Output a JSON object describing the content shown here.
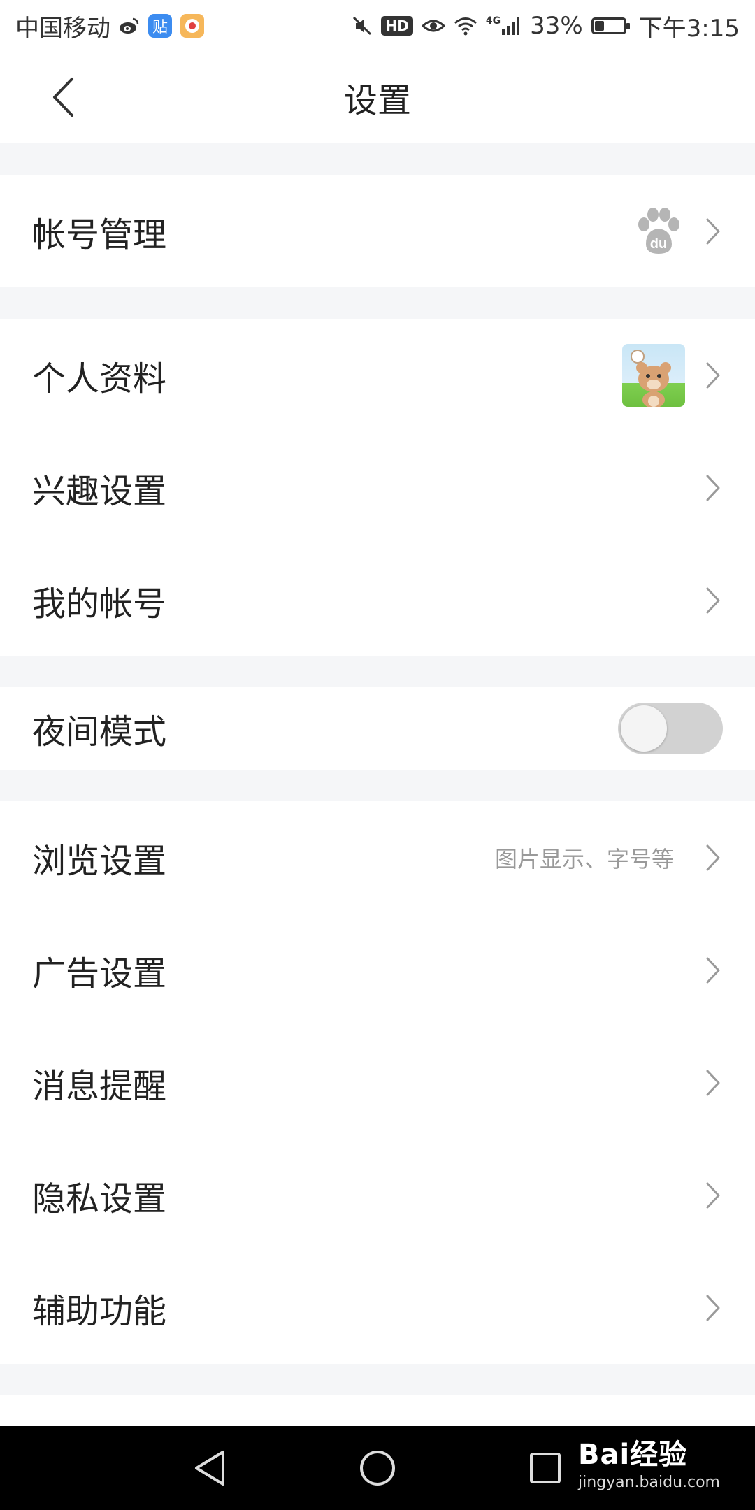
{
  "status_bar": {
    "carrier": "中国移动",
    "app_badges": [
      "weibo-icon",
      "tieba-icon",
      "cartoon-app-icon"
    ],
    "tieba_badge_text": "贴",
    "hd_label": "HD",
    "network_label": "4G",
    "battery_percent": "33%",
    "battery_level": 0.33,
    "time": "下午3:15"
  },
  "header": {
    "title": "设置",
    "back_icon": "chevron-left-icon"
  },
  "sections": {
    "account": {
      "label": "帐号管理",
      "right_icon": "baidu-paw-icon",
      "paw_text": "du"
    },
    "profile": {
      "personal_info": "个人资料",
      "interest_settings": "兴趣设置",
      "my_account": "我的帐号"
    },
    "night": {
      "label": "夜间模式",
      "toggle_on": false
    },
    "general": {
      "browse_settings": "浏览设置",
      "browse_subtext": "图片显示、字号等",
      "ad_settings": "广告设置",
      "message_reminder": "消息提醒",
      "privacy_settings": "隐私设置",
      "accessibility": "辅助功能"
    }
  },
  "nav_bar": {
    "buttons": [
      "back-triangle-icon",
      "home-circle-icon",
      "recents-square-icon"
    ],
    "watermark_main": "Bai经验",
    "watermark_sub": "jingyan.baidu.com"
  },
  "colors": {
    "background": "#f5f6f8",
    "surface": "#ffffff",
    "text_primary": "#222222",
    "text_secondary": "#999999",
    "toggle_off": "#d2d2d2",
    "nav_bar": "#000000"
  }
}
